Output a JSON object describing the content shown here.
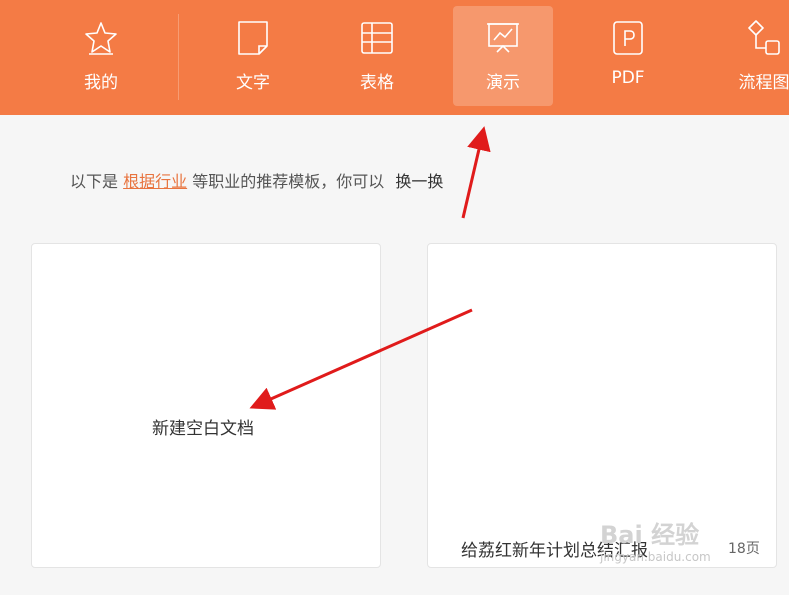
{
  "topnav": {
    "items": [
      {
        "label": "我的",
        "icon": "star-icon"
      },
      {
        "label": "文字",
        "icon": "document-icon"
      },
      {
        "label": "表格",
        "icon": "table-icon"
      },
      {
        "label": "演示",
        "icon": "presentation-icon",
        "active": true
      },
      {
        "label": "PDF",
        "icon": "pdf-icon"
      },
      {
        "label": "流程图",
        "icon": "flowchart-icon"
      }
    ],
    "background_color": "#f47b45"
  },
  "hint": {
    "prefix": "以下是",
    "link": "根据行业",
    "suffix": "等职业的推荐模板，你可以",
    "swap": "换一换"
  },
  "cards": [
    {
      "title": "新建空白文档"
    },
    {
      "title": "给荔红新年计划总结汇报",
      "pages": "18页"
    }
  ],
  "watermark": {
    "logo": "Bai 经验",
    "url": "jingyan.baidu.com"
  },
  "annotations": {
    "arrow_color": "#e01b1b"
  }
}
